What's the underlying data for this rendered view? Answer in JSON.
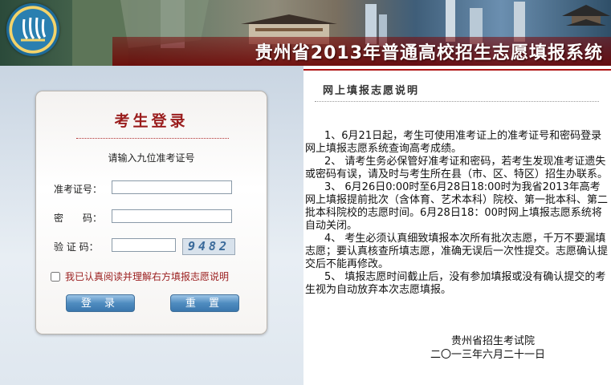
{
  "header": {
    "title": "贵州省2013年普通高校招生志愿填报系统"
  },
  "login": {
    "title": "考生登录",
    "hint": "请输入九位准考证号",
    "fields": {
      "exam_id_label": "准考证号：",
      "password_label": "密　　码：",
      "captcha_label": "验 证 码：",
      "exam_id_value": "",
      "password_value": "",
      "captcha_value": ""
    },
    "captcha_text": "9482",
    "agree_label": "我已认真阅读并理解右方填报志愿说明",
    "login_button": "登 录",
    "reset_button": "重 置"
  },
  "notice": {
    "title": "网上填报志愿说明",
    "paragraphs": [
      "1、6月21日起，考生可使用准考证上的准考证号和密码登录网上填报志愿系统查询高考成绩。",
      "2、 请考生务必保管好准考证和密码，若考生发现准考证遗失或密码有误，请及时与考生所在县（市、区、特区）招生办联系。",
      "3、 6月26日0:00时至6月28日18:00时为我省2013年高考网上填报提前批次（含体育、艺术本科）院校、第一批本科、第二批本科院校的志愿时间。6月28日18：00时网上填报志愿系统将自动关闭。",
      "4、 考生必须认真细致填报本次所有批次志愿，千万不要漏填志愿；要认真核查所填志愿，准确无误后一次性提交。志愿确认提交后不能再修改。",
      "5、 填报志愿时间截止后，没有参加填报或没有确认提交的考生视为自动放弃本次志愿填报。"
    ],
    "signature_org": "贵州省招生考试院",
    "signature_date": "二〇一三年六月二十一日"
  },
  "colors": {
    "accent_red": "#9a1d1d",
    "button_blue": "#4f8cc0"
  },
  "icons": {
    "logo": "guizhou-exam-emblem",
    "checkbox": "checkbox"
  }
}
